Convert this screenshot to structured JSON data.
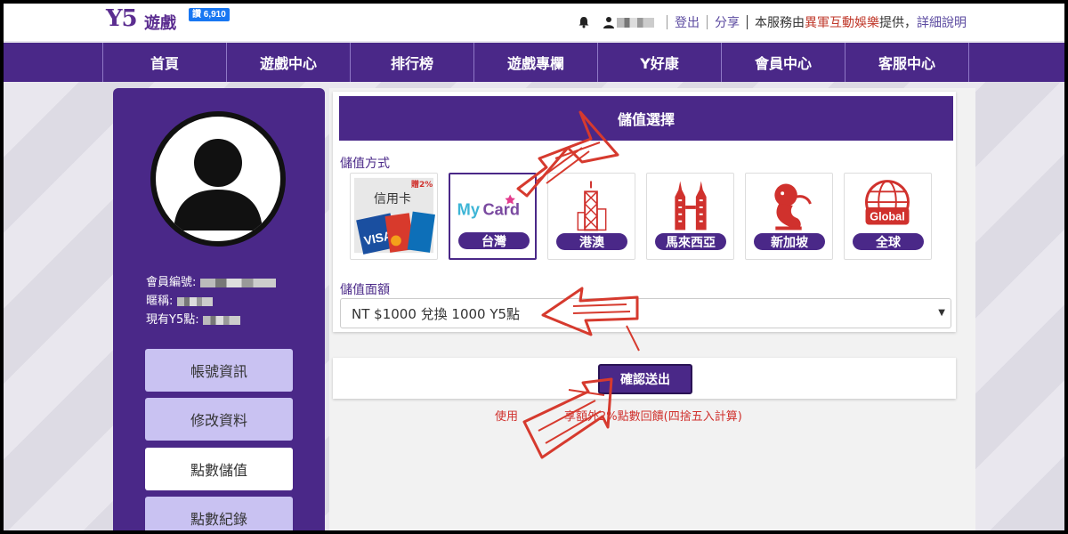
{
  "header": {
    "logo": "Y5",
    "logo_sub": "遊戲",
    "like_count": "讚 6,910",
    "logout": "登出",
    "share": "分享",
    "service_prefix": "本服務由",
    "service_company": "異軍互動娛樂",
    "service_suffix": "提供，",
    "details": "詳細說明"
  },
  "nav": [
    "首頁",
    "遊戲中心",
    "排行榜",
    "遊戲專欄",
    "Y好康",
    "會員中心",
    "客服中心"
  ],
  "sidebar": {
    "member_id_label": "會員編號:",
    "nickname_label": "暱稱:",
    "points_label": "現有Y5點:",
    "buttons": [
      "帳號資訊",
      "修改資料",
      "點數儲值",
      "點數紀錄"
    ],
    "active": "點數儲值"
  },
  "main": {
    "title": "儲值選擇",
    "method_label": "儲值方式",
    "methods": [
      {
        "label": "信用卡",
        "badge": "贈2%",
        "icon": "credit-card-icon"
      },
      {
        "label": "台灣",
        "logo": "MyCard",
        "icon": "mycard-logo"
      },
      {
        "label": "港澳",
        "icon": "hong-kong-tower-icon"
      },
      {
        "label": "馬來西亞",
        "icon": "petronas-towers-icon"
      },
      {
        "label": "新加坡",
        "icon": "merlion-icon"
      },
      {
        "label": "全球",
        "logo": "Global",
        "icon": "globe-icon"
      }
    ],
    "selected_method": "台灣",
    "amount_label": "儲值面額",
    "amount_value": "NT $1000 兌換 1000 Y5點",
    "submit": "確認送出",
    "note_visible": "使用",
    "note_tail": "享額外2%點數回饋(四捨五入計算)"
  },
  "colors": {
    "brand": "#4a2888",
    "accent_link": "#5b4aa0",
    "note_red": "#d0312d",
    "arrow_red": "#d63a2e"
  }
}
